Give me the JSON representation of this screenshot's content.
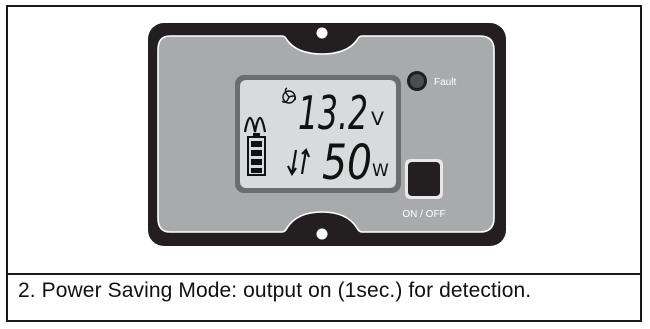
{
  "panel": {
    "fault_label": "Fault",
    "power_button_label": "ON / OFF",
    "lcd": {
      "voltage_value": "13.2",
      "voltage_unit": "V",
      "power_value": "50",
      "power_unit": "W"
    }
  },
  "caption": "2. Power Saving Mode: output on (1sec.) for detection.",
  "colors": {
    "housing": "#231f20",
    "faceplate": "#a9aaac",
    "lcd_background": "#d9dadb",
    "fault_led": "#4d4d4d"
  }
}
